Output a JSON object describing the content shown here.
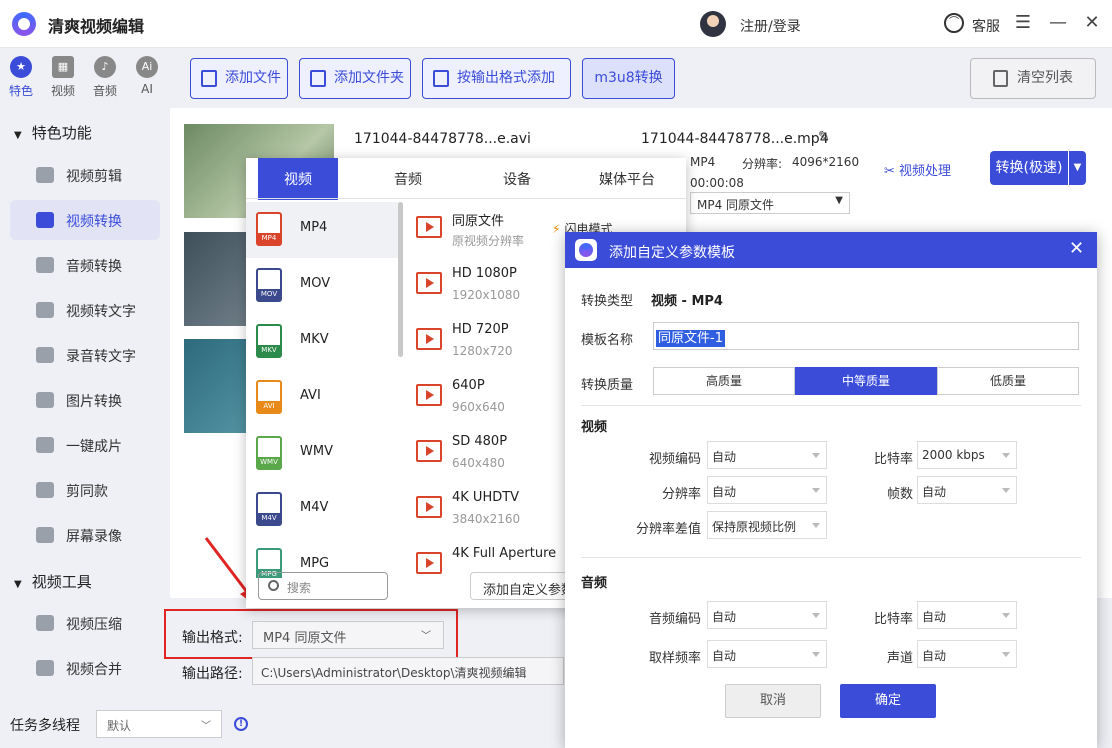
{
  "app": {
    "title": "清爽视频编辑",
    "login": "注册/登录",
    "service": "客服"
  },
  "left_tabs": [
    {
      "label": "特色",
      "icon": "star-icon"
    },
    {
      "label": "视频",
      "icon": "film-icon"
    },
    {
      "label": "音频",
      "icon": "audio-icon"
    },
    {
      "label": "AI",
      "icon": "ai-icon"
    }
  ],
  "sidebar": {
    "section1": "特色功能",
    "items1": [
      "视频剪辑",
      "视频转换",
      "音频转换",
      "视频转文字",
      "录音转文字",
      "图片转换",
      "一键成片",
      "剪同款",
      "屏幕录像"
    ],
    "section2": "视频工具",
    "items2": [
      "视频压缩",
      "视频合并"
    ],
    "active": "视频转换"
  },
  "toolbar": {
    "add_file": "添加文件",
    "add_folder": "添加文件夹",
    "add_by_format": "按输出格式添加",
    "m3u8": "m3u8转换",
    "clear_list": "清空列表"
  },
  "file": {
    "src_name": "171044-84478778...e.avi",
    "dst_name": "171044-84478778...e.mp4",
    "dst_format": "MP4",
    "resolution_label": "分辨率:",
    "resolution": "4096*2160",
    "duration": "00:00:08",
    "format_select": "MP4  同原文件",
    "video_process": "视频处理",
    "convert": "转换(极速)"
  },
  "bottom": {
    "output_format_label": "输出格式:",
    "output_format_value": "MP4  同原文件",
    "output_path_label": "输出路径:",
    "output_path_value": "C:\\Users\\Administrator\\Desktop\\清爽视频编辑",
    "task_label": "任务多线程",
    "task_value": "默认"
  },
  "popup": {
    "tabs": [
      "视频",
      "音频",
      "设备",
      "媒体平台"
    ],
    "formats": [
      "MP4",
      "MOV",
      "MKV",
      "AVI",
      "WMV",
      "M4V",
      "MPG"
    ],
    "format_colors": [
      "#d9442b",
      "#3a4a8c",
      "#2c8a4a",
      "#e88a1a",
      "#5aa84a",
      "#3a4a8c",
      "#3a9a7a"
    ],
    "presets": [
      {
        "name": "同原文件",
        "res": "原视频分辨率"
      },
      {
        "name": "HD 1080P",
        "res": "1920x1080"
      },
      {
        "name": "HD 720P",
        "res": "1280x720"
      },
      {
        "name": "640P",
        "res": "960x640"
      },
      {
        "name": "SD 480P",
        "res": "640x480"
      },
      {
        "name": "4K UHDTV",
        "res": "3840x2160"
      },
      {
        "name": "4K Full Aperture",
        "res": ""
      }
    ],
    "flash_mode": "闪电模式",
    "search_placeholder": "搜索",
    "add_custom": "添加自定义参数"
  },
  "dialog": {
    "title": "添加自定义参数模板",
    "type_label": "转换类型",
    "type_value": "视频 - MP4",
    "name_label": "模板名称",
    "name_value": "同原文件-1",
    "quality_label": "转换质量",
    "qualities": [
      "高质量",
      "中等质量",
      "低质量"
    ],
    "video_section": "视频",
    "video_codec_label": "视频编码",
    "video_codec": "自动",
    "bitrate_label": "比特率",
    "bitrate": "2000 kbps",
    "resolution_label": "分辨率",
    "resolution": "自动",
    "fps_label": "帧数",
    "fps": "自动",
    "res_diff_label": "分辨率差值",
    "res_diff": "保持原视频比例",
    "audio_section": "音频",
    "audio_codec_label": "音频编码",
    "audio_codec": "自动",
    "audio_bitrate_label": "比特率",
    "audio_bitrate": "自动",
    "sample_label": "取样频率",
    "sample": "自动",
    "channel_label": "声道",
    "channel": "自动",
    "cancel": "取消",
    "ok": "确定"
  }
}
